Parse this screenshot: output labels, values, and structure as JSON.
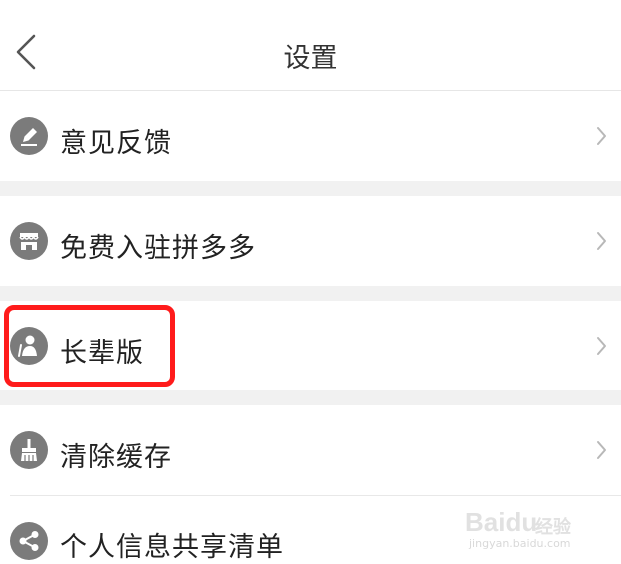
{
  "header": {
    "title": "设置"
  },
  "items": [
    {
      "label": "意见反馈",
      "icon": "edit-icon"
    },
    {
      "label": "免费入驻拼多多",
      "icon": "store-icon"
    },
    {
      "label": "长辈版",
      "icon": "elder-icon"
    },
    {
      "label": "清除缓存",
      "icon": "broom-icon"
    },
    {
      "label": "个人信息共享清单",
      "icon": "share-icon"
    }
  ],
  "colors": {
    "highlight": "#ff1b1b",
    "icon_bg": "#7b7b7b",
    "separator": "#f1f1f1"
  },
  "watermark": {
    "brand": "Baidu",
    "sub": "经验",
    "url": "jingyan.baidu.com"
  }
}
